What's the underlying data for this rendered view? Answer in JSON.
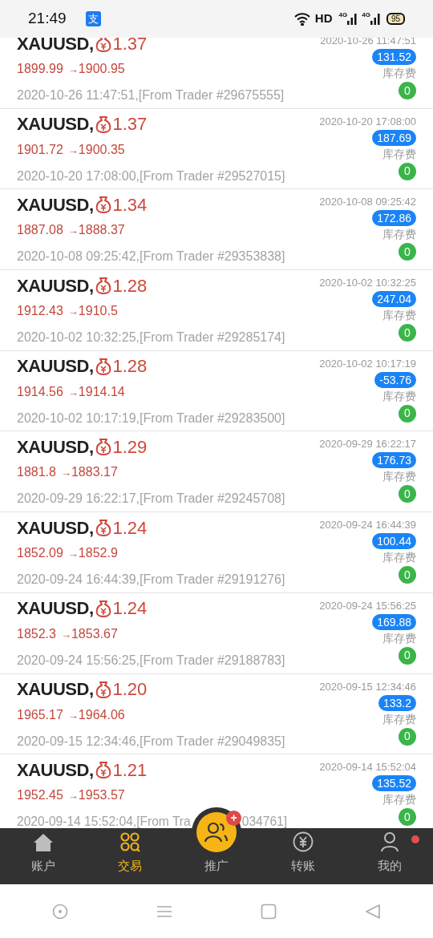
{
  "status_bar": {
    "time": "21:49",
    "app_glyph": "支",
    "hd": "HD",
    "net1": "4G",
    "net2": "4G",
    "battery": "95"
  },
  "rows": [
    {
      "symbol": "XAUUSD,",
      "lots": "1.37",
      "open": "1899.99",
      "arrow": "→",
      "close": "1900.95",
      "note": "2020-10-26 11:47:51,[From Trader #29675555]",
      "time": "2020-10-26 11:47:51",
      "profit": "131.52",
      "fee_label": "库存费",
      "swap": "0"
    },
    {
      "symbol": "XAUUSD,",
      "lots": "1.37",
      "open": "1901.72",
      "arrow": "→",
      "close": "1900.35",
      "note": "2020-10-20 17:08:00,[From Trader #29527015]",
      "time": "2020-10-20 17:08:00",
      "profit": "187.69",
      "fee_label": "库存费",
      "swap": "0"
    },
    {
      "symbol": "XAUUSD,",
      "lots": "1.34",
      "open": "1887.08",
      "arrow": "→",
      "close": "1888.37",
      "note": "2020-10-08 09:25:42,[From Trader #29353838]",
      "time": "2020-10-08 09:25:42",
      "profit": "172.86",
      "fee_label": "库存费",
      "swap": "0"
    },
    {
      "symbol": "XAUUSD,",
      "lots": "1.28",
      "open": "1912.43",
      "arrow": "→",
      "close": "1910.5",
      "note": "2020-10-02 10:32:25,[From Trader #29285174]",
      "time": "2020-10-02 10:32:25",
      "profit": "247.04",
      "fee_label": "库存费",
      "swap": "0"
    },
    {
      "symbol": "XAUUSD,",
      "lots": "1.28",
      "open": "1914.56",
      "arrow": "→",
      "close": "1914.14",
      "note": "2020-10-02 10:17:19,[From Trader #29283500]",
      "time": "2020-10-02 10:17:19",
      "profit": "-53.76",
      "fee_label": "库存费",
      "swap": "0"
    },
    {
      "symbol": "XAUUSD,",
      "lots": "1.29",
      "open": "1881.8",
      "arrow": "→",
      "close": "1883.17",
      "note": "2020-09-29 16:22:17,[From Trader #29245708]",
      "time": "2020-09-29 16:22:17",
      "profit": "176.73",
      "fee_label": "库存费",
      "swap": "0"
    },
    {
      "symbol": "XAUUSD,",
      "lots": "1.24",
      "open": "1852.09",
      "arrow": "→",
      "close": "1852.9",
      "note": "2020-09-24 16:44:39,[From Trader #29191276]",
      "time": "2020-09-24 16:44:39",
      "profit": "100.44",
      "fee_label": "库存费",
      "swap": "0"
    },
    {
      "symbol": "XAUUSD,",
      "lots": "1.24",
      "open": "1852.3",
      "arrow": "→",
      "close": "1853.67",
      "note": "2020-09-24 15:56:25,[From Trader #29188783]",
      "time": "2020-09-24 15:56:25",
      "profit": "169.88",
      "fee_label": "库存费",
      "swap": "0"
    },
    {
      "symbol": "XAUUSD,",
      "lots": "1.20",
      "open": "1965.17",
      "arrow": "→",
      "close": "1964.06",
      "note": "2020-09-15 12:34:46,[From Trader #29049835]",
      "time": "2020-09-15 12:34:46",
      "profit": "133.2",
      "fee_label": "库存费",
      "swap": "0"
    },
    {
      "symbol": "XAUUSD,",
      "lots": "1.21",
      "open": "1952.45",
      "arrow": "→",
      "close": "1953.57",
      "note_parts": [
        "2020-09-14 15:52:04,[From Tra",
        "034761]"
      ],
      "time": "2020-09-14 15:52:04",
      "profit": "135.52",
      "fee_label": "库存费",
      "swap": "0"
    }
  ],
  "tabs": [
    {
      "kind": "home",
      "label": "账户",
      "selected": false,
      "dot": false
    },
    {
      "kind": "trade",
      "label": "交易",
      "selected": true,
      "dot": false
    },
    {
      "kind": "promote",
      "label": "推广",
      "selected": false,
      "dot": false,
      "badge": "+"
    },
    {
      "kind": "transfer",
      "label": "转账",
      "selected": false,
      "dot": false
    },
    {
      "kind": "me",
      "label": "我的",
      "selected": false,
      "dot": true
    }
  ]
}
